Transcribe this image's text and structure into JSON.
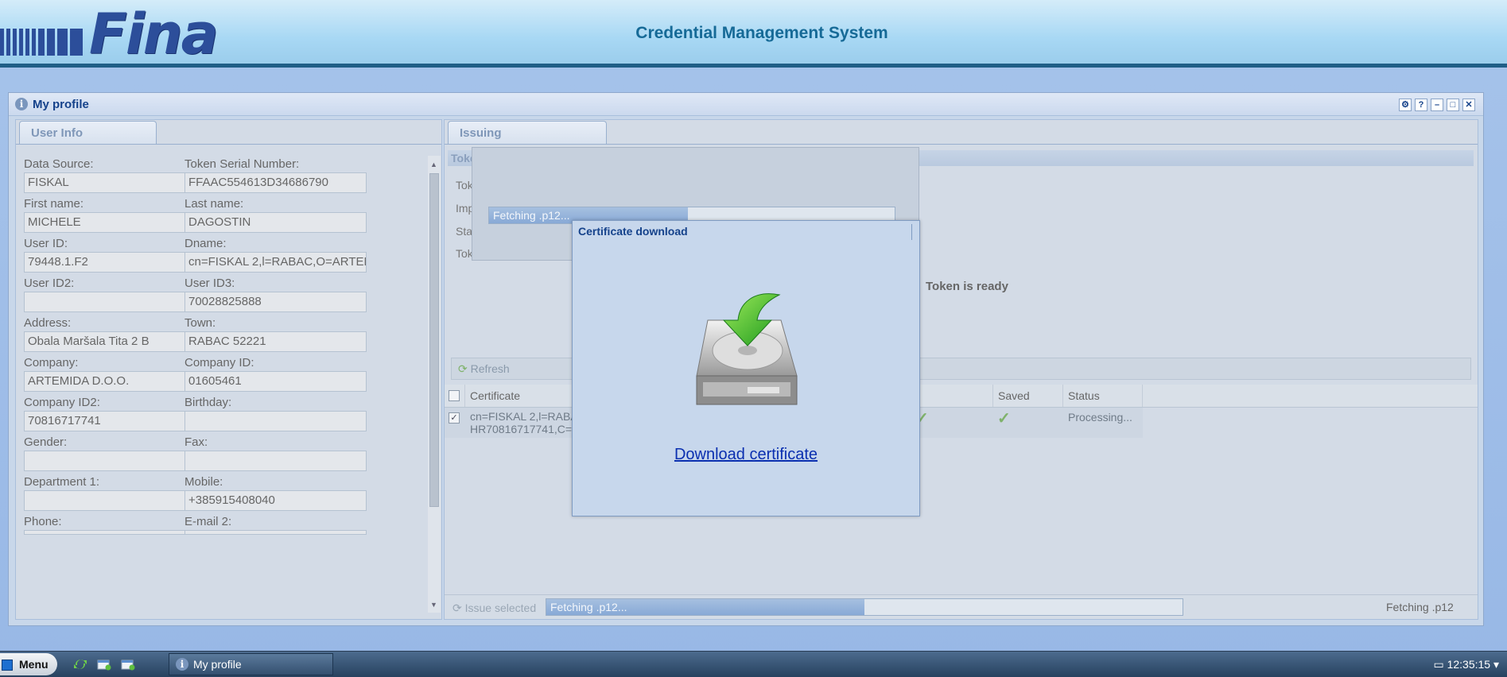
{
  "header": {
    "logo_text": "Fina",
    "title": "Credential Management System"
  },
  "window": {
    "title": "My profile",
    "tools": [
      "gear",
      "?",
      "–",
      "□",
      "✕"
    ]
  },
  "user_info": {
    "tab": "User Info",
    "fields": [
      {
        "label": "Data Source:",
        "value": "FISKAL"
      },
      {
        "label": "Token Serial Number:",
        "value": "FFAAC554613D34686790"
      },
      {
        "label": "First name:",
        "value": "MICHELE"
      },
      {
        "label": "Last name:",
        "value": "DAGOSTIN"
      },
      {
        "label": "User ID:",
        "value": "79448.1.F2"
      },
      {
        "label": "Dname:",
        "value": "cn=FISKAL 2,l=RABAC,O=ARTEM"
      },
      {
        "label": "User ID2:",
        "value": ""
      },
      {
        "label": "User ID3:",
        "value": "70028825888"
      },
      {
        "label": "Address:",
        "value": "Obala Maršala Tita 2 B"
      },
      {
        "label": "Town:",
        "value": "RABAC 52221"
      },
      {
        "label": "Company:",
        "value": "ARTEMIDA D.O.O."
      },
      {
        "label": "Company ID:",
        "value": "01605461"
      },
      {
        "label": "Company ID2:",
        "value": "70816717741"
      },
      {
        "label": "Birthday:",
        "value": ""
      },
      {
        "label": "Gender:",
        "value": ""
      },
      {
        "label": "Fax:",
        "value": ""
      },
      {
        "label": "Department 1:",
        "value": ""
      },
      {
        "label": "Mobile:",
        "value": "+385915408040"
      },
      {
        "label": "Phone:",
        "value": ""
      },
      {
        "label": "E-mail 2:",
        "value": ""
      }
    ]
  },
  "issuing": {
    "tab": "Issuing",
    "section_head": "Toke",
    "side_labels": [
      "Tok",
      "Imp",
      "Sta",
      "Tok"
    ],
    "token_status": "Token is ready",
    "refresh_label": "Refresh",
    "grid": {
      "columns": [
        "Certificate",
        "Saved",
        "Status"
      ],
      "row": {
        "certificate_line1": "cn=FISKAL 2,l=RABA",
        "certificate_line2": "HR70816717741,C=I",
        "status": "Processing..."
      }
    },
    "issue_selected_label": "Issue selected",
    "bottom_progress_text": "Fetching .p12...",
    "bottom_progress": 0.5,
    "status_text": "Fetching .p12"
  },
  "fetch_dialog": {
    "progress_text": "Fetching .p12...",
    "progress": 0.49
  },
  "cert_dialog": {
    "title": "Certificate download",
    "link": "Download certificate"
  },
  "taskbar": {
    "menu_label": "Menu",
    "task_item": "My profile",
    "clock": "12:35:15"
  },
  "colors": {
    "accent": "#15428b",
    "header_border": "#1f5e86",
    "link": "#0a2fb0"
  }
}
